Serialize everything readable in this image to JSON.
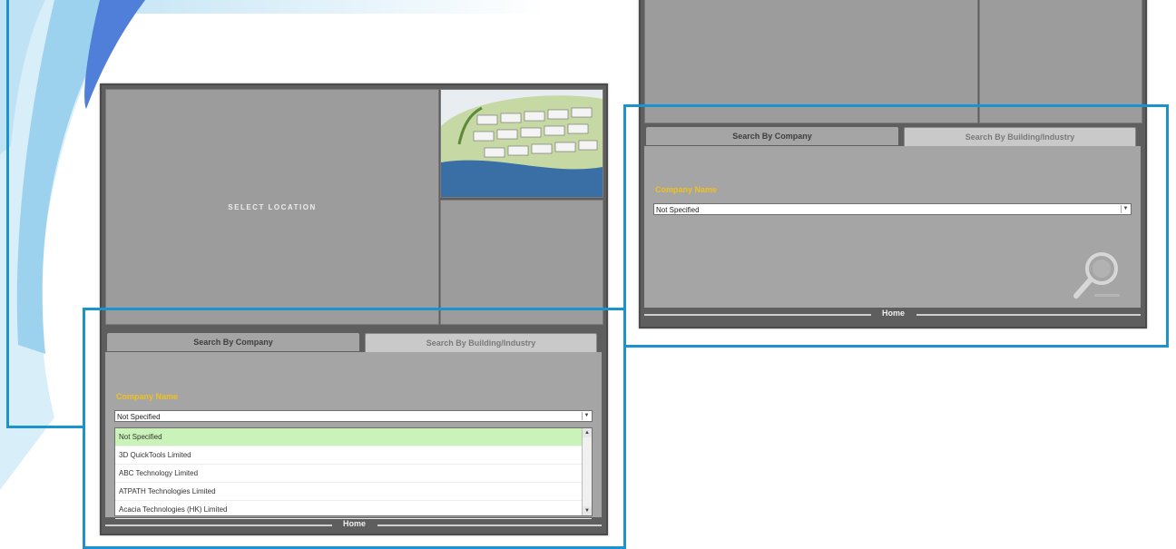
{
  "left_panel": {
    "select_location": "SELECT LOCATION",
    "tabs": [
      "Search By Company",
      "Search By Building/Industry"
    ],
    "company_label": "Company Name",
    "selected_value": "Not Specified",
    "dropdown_options": [
      "Not Specified",
      "3D QuickTools Limited",
      "ABC Technology Limited",
      "ATPATH Technologies Limited",
      "Acacia Technologies (HK) Limited"
    ],
    "home_label": "Home"
  },
  "right_panel": {
    "tabs": [
      "Search By Company",
      "Search By Building/Industry"
    ],
    "company_label": "Company Name",
    "selected_value": "Not Specified",
    "home_label": "Home"
  },
  "colors": {
    "accent_frame": "#1a93cf",
    "label_yellow": "#f0c020",
    "selected_option": "#c9f3b9"
  }
}
